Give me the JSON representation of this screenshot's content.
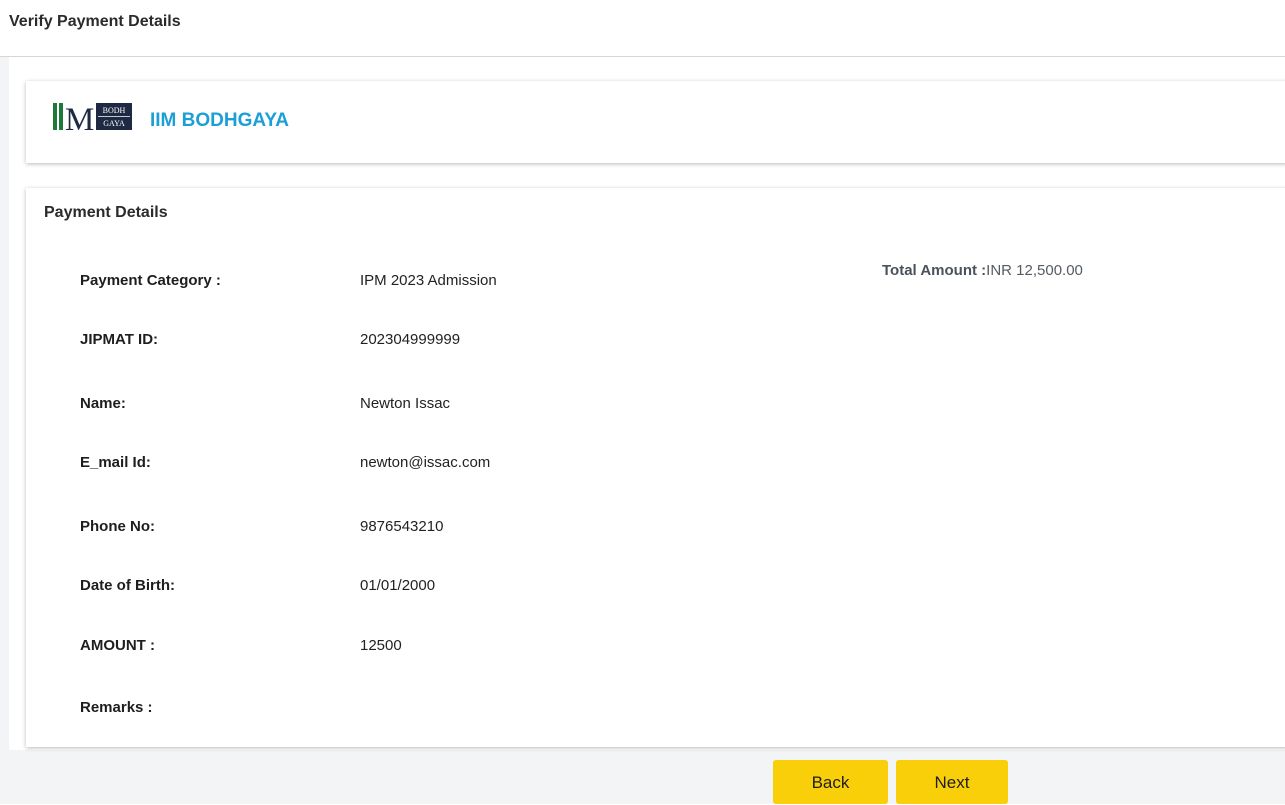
{
  "header": {
    "title": "Verify Payment Details"
  },
  "brand": {
    "logo_text_main": "IIM",
    "logo_text_top": "BODH",
    "logo_text_bottom": "GAYA",
    "name": "IIM BODHGAYA",
    "name_color": "#1c9ed6"
  },
  "details": {
    "section_title": "Payment Details",
    "total_amount_label": "Total Amount :",
    "total_amount_value": "INR 12,500.00",
    "rows": [
      {
        "label": "Payment Category :",
        "value": "IPM 2023 Admission"
      },
      {
        "label": "JIPMAT ID:",
        "value": "202304999999"
      },
      {
        "label": "Name:",
        "value": "Newton Issac"
      },
      {
        "label": "E_mail Id:",
        "value": "newton@issac.com"
      },
      {
        "label": "Phone No:",
        "value": "9876543210"
      },
      {
        "label": "Date of Birth:",
        "value": "01/01/2000"
      },
      {
        "label": "AMOUNT :",
        "value": "12500"
      },
      {
        "label": "Remarks :",
        "value": ""
      }
    ]
  },
  "actions": {
    "back_label": "Back",
    "next_label": "Next",
    "button_color": "#f9cf0a"
  }
}
